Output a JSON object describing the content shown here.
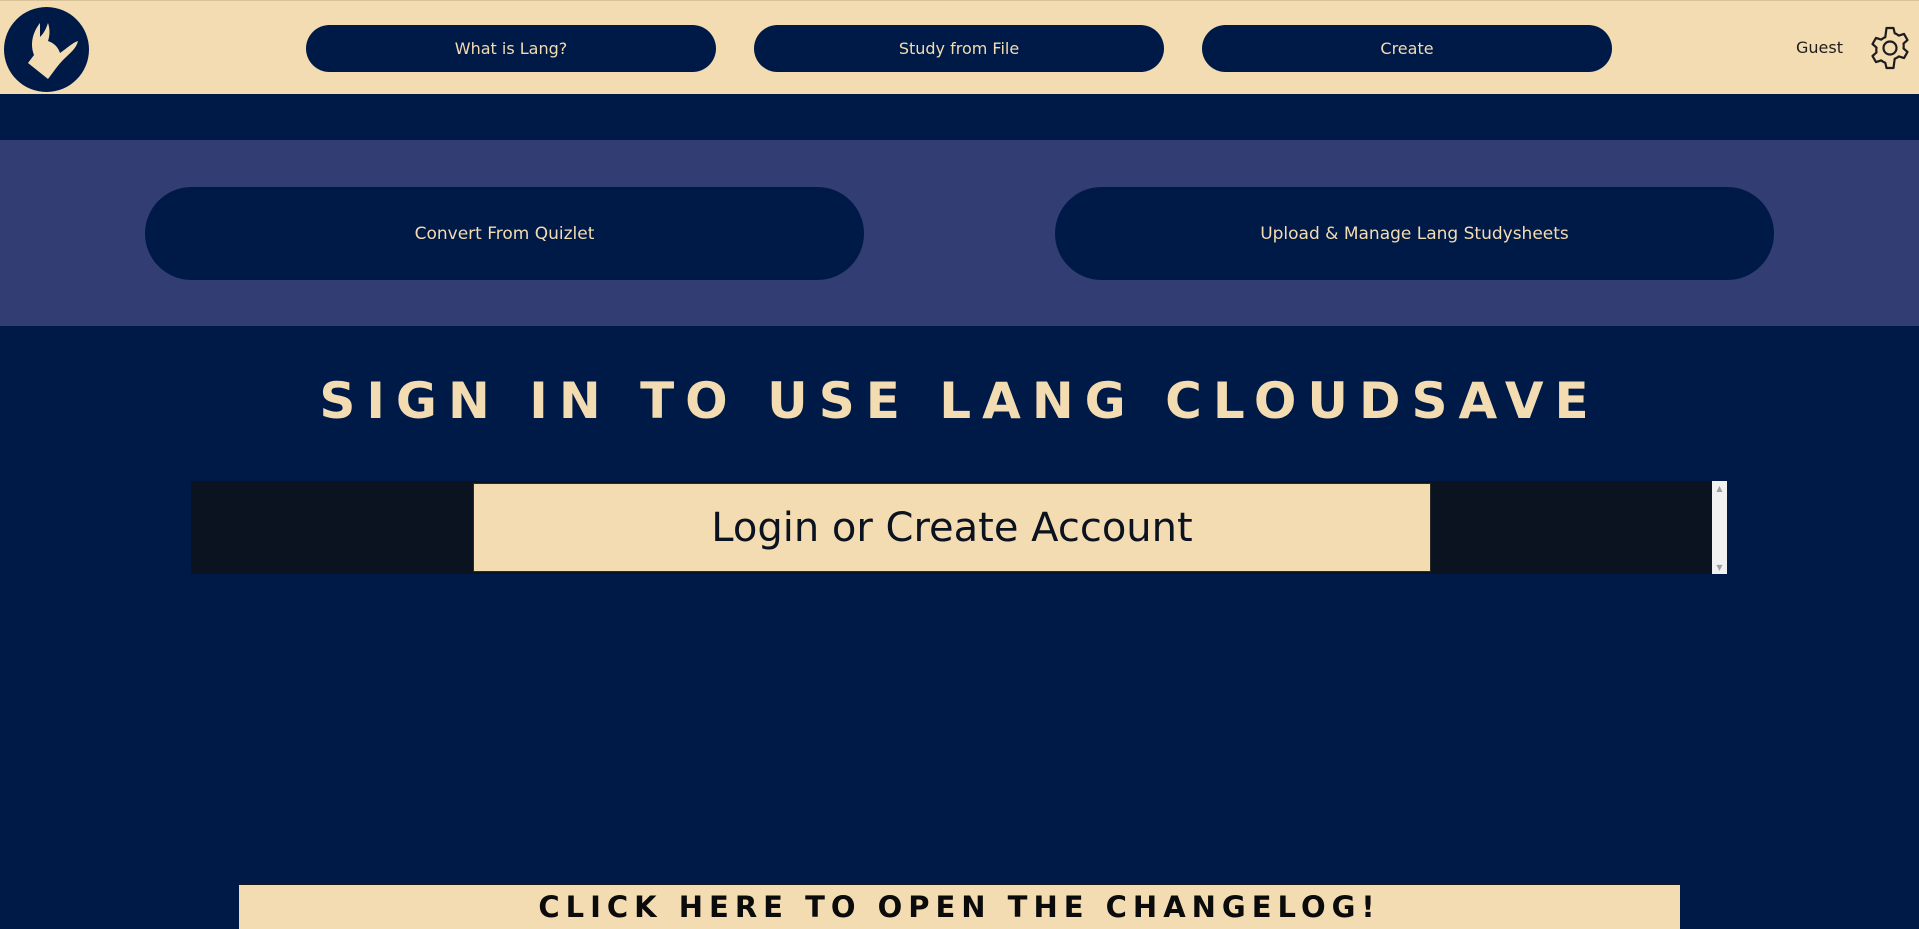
{
  "header": {
    "logo_icon": "lang-logo-icon",
    "nav": [
      {
        "label": "What is Lang?"
      },
      {
        "label": "Study from File"
      },
      {
        "label": "Create"
      }
    ],
    "user_label": "Guest",
    "settings_icon": "gear-icon"
  },
  "actions": {
    "convert_label": "Convert From Quizlet",
    "upload_label": "Upload & Manage Lang Studysheets"
  },
  "main": {
    "heading": "Sign in to use Lang Cloudsave",
    "login_label": "Login or Create Account"
  },
  "footer": {
    "changelog_label": "Click here to open the changelog!"
  },
  "colors": {
    "cream": "#f4dcb2",
    "navy": "#001a47",
    "band": "#313d73",
    "frame": "#0b1220"
  }
}
